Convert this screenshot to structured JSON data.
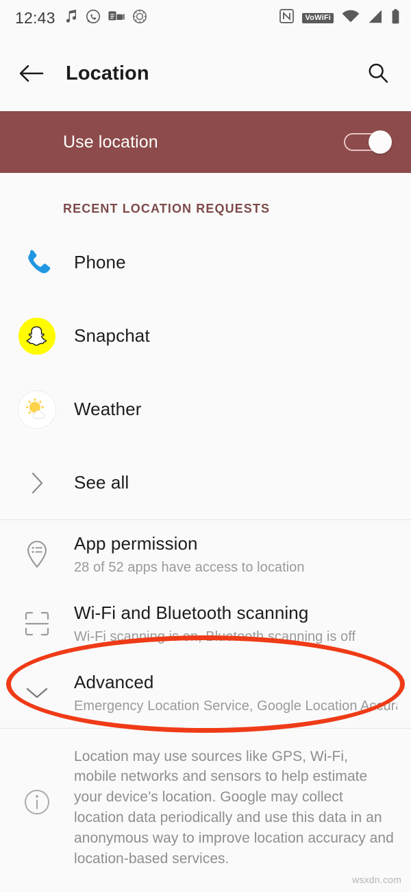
{
  "status_bar": {
    "clock": "12:43",
    "left_icons": [
      "music-note-icon",
      "whatsapp-icon",
      "outlook-icon",
      "soccer-ball-icon"
    ],
    "right_icons": [
      "nfc-icon",
      "vowifi-badge",
      "wifi-icon",
      "cellular-signal-icon",
      "battery-icon"
    ],
    "vowifi_label": "VoWiFi"
  },
  "app_bar": {
    "back_icon": "back-arrow-icon",
    "title": "Location",
    "search_icon": "search-icon"
  },
  "master_toggle": {
    "label": "Use location",
    "state": "on"
  },
  "recent_requests": {
    "header": "RECENT LOCATION REQUESTS",
    "apps": [
      {
        "name": "Phone",
        "icon": "phone-app-icon"
      },
      {
        "name": "Snapchat",
        "icon": "snapchat-app-icon"
      },
      {
        "name": "Weather",
        "icon": "weather-app-icon"
      }
    ],
    "see_all": {
      "label": "See all",
      "icon": "chevron-right-icon"
    }
  },
  "settings": [
    {
      "title": "App permission",
      "subtitle": "28 of 52 apps have access to location",
      "icon": "location-pin-list-icon"
    },
    {
      "title": "Wi-Fi and Bluetooth scanning",
      "subtitle": "Wi-Fi scanning is on, Bluetooth scanning is off",
      "icon": "scan-brackets-icon"
    },
    {
      "title": "Advanced",
      "subtitle": "Emergency Location Service, Google Location Accurac··",
      "icon": "chevron-down-icon"
    }
  ],
  "footer": {
    "icon": "info-icon",
    "text": "Location may use sources like GPS, Wi-Fi, mobile networks and sensors to help estimate your device’s location. Google may collect location data periodically and use this data in an anonymous way to improve location accuracy and location-based services."
  },
  "annotation": {
    "shape": "ellipse",
    "color": "#ef3b17",
    "target": "Advanced"
  },
  "watermark": "wsxdn.com",
  "colors": {
    "banner": "#8d4b4b",
    "accent_header": "#7e4a4a",
    "background": "#fafafa",
    "annotation": "#ef3b17"
  }
}
